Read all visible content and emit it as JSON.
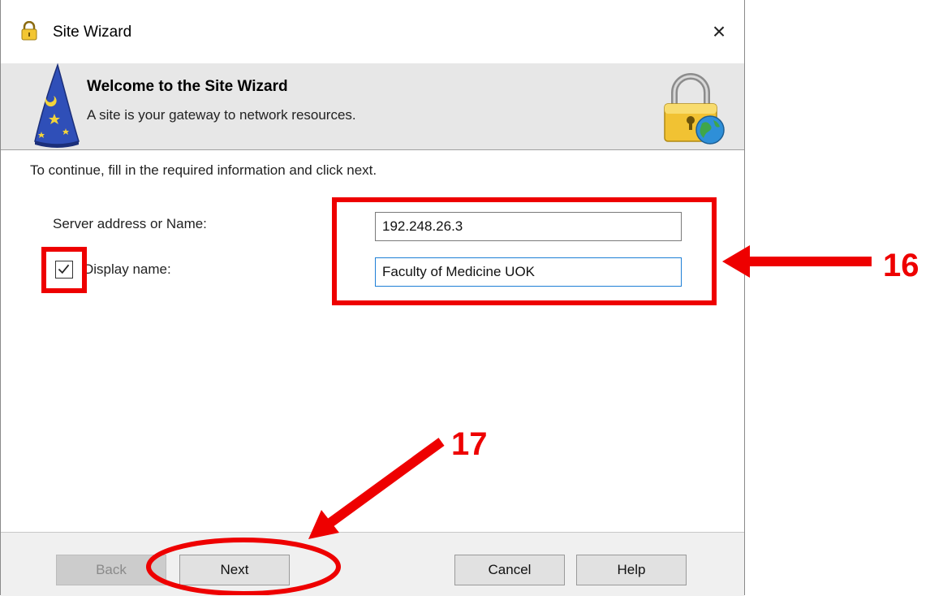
{
  "window": {
    "title": "Site Wizard",
    "close_glyph": "×"
  },
  "banner": {
    "title": "Welcome to the Site Wizard",
    "subtitle": "A site is your gateway to network resources."
  },
  "form": {
    "instructions": "To continue, fill in the required information and click next.",
    "server_label": "Server address or Name:",
    "server_value": "192.248.26.3",
    "display_label": "Display name:",
    "display_checked": true,
    "display_value": "Faculty of Medicine UOK"
  },
  "footer": {
    "back_label": "Back",
    "next_label": "Next",
    "cancel_label": "Cancel",
    "help_label": "Help"
  },
  "annotations": {
    "step_16": "16",
    "step_17": "17",
    "color": "#ee0000"
  },
  "icons": [
    "padlock-icon",
    "wizard-hat-icon",
    "lock-globe-icon",
    "checkbox-check-icon"
  ]
}
